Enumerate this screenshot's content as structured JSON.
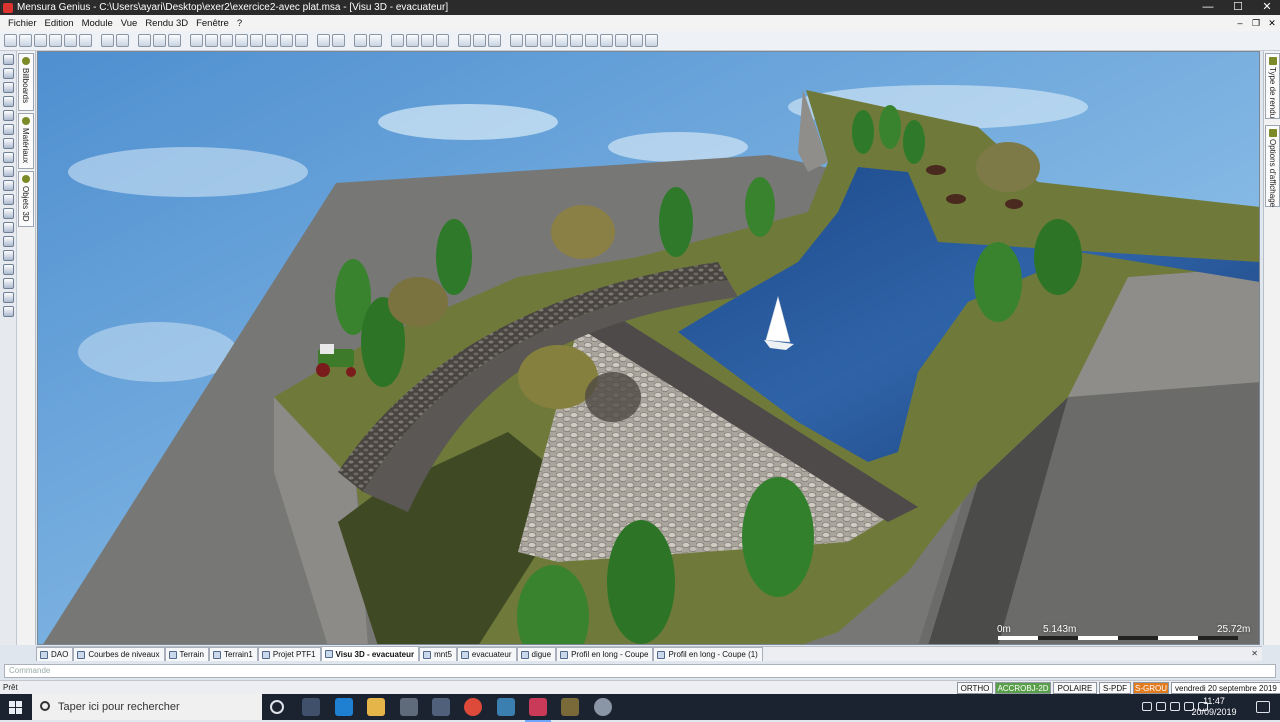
{
  "window": {
    "title": "Mensura Genius - C:\\Users\\ayari\\Desktop\\exer2\\exercice2-avec plat.msa - [Visu 3D - evacuateur]",
    "minimize": "—",
    "maximize": "☐",
    "close": "✕"
  },
  "menu": {
    "items": [
      "Fichier",
      "Edition",
      "Module",
      "Vue",
      "Rendu 3D",
      "Fenêtre",
      "?"
    ],
    "mdi_minimize": "–",
    "mdi_restore": "❐",
    "mdi_close": "✕"
  },
  "left_panels": {
    "tabs": [
      {
        "label": "Billboards"
      },
      {
        "label": "Matériaux"
      },
      {
        "label": "Objets 3D"
      }
    ]
  },
  "right_panels": {
    "tabs": [
      {
        "label": "Type de rendu"
      },
      {
        "label": "Options d'affichage"
      }
    ]
  },
  "viewport": {
    "scale_labels": [
      "0m",
      "5.143m",
      "25.72m"
    ],
    "colors": {
      "sky": "#6ea7dd",
      "ground": "#7a7a78",
      "grass": "#6f7a3a",
      "water": "#244f8e",
      "stone": "#b8b4ad",
      "road": "#4d4a49"
    }
  },
  "doc_tabs": {
    "items": [
      {
        "label": "DAO",
        "active": false
      },
      {
        "label": "Courbes de niveaux",
        "active": false
      },
      {
        "label": "Terrain",
        "active": false
      },
      {
        "label": "Terrain1",
        "active": false
      },
      {
        "label": "Projet PTF1",
        "active": false
      },
      {
        "label": "Visu 3D - evacuateur",
        "active": true
      },
      {
        "label": "mnt5",
        "active": false
      },
      {
        "label": "evacuateur",
        "active": false
      },
      {
        "label": "digue",
        "active": false
      },
      {
        "label": "Profil en long - Coupe",
        "active": false
      },
      {
        "label": "Profil en long - Coupe (1)",
        "active": false
      }
    ],
    "close": "✕"
  },
  "command_line": {
    "placeholder": "Commande"
  },
  "status": {
    "text": "Prêt",
    "modes": [
      "ORTHO",
      "ACCROBJ-2D",
      "POLAIRE",
      "S-PDF",
      "S-GROU"
    ],
    "date": "vendredi 20 septembre 2019"
  },
  "taskbar": {
    "search_placeholder": "Taper ici pour rechercher",
    "time": "11:47",
    "date": "20/09/2019"
  }
}
